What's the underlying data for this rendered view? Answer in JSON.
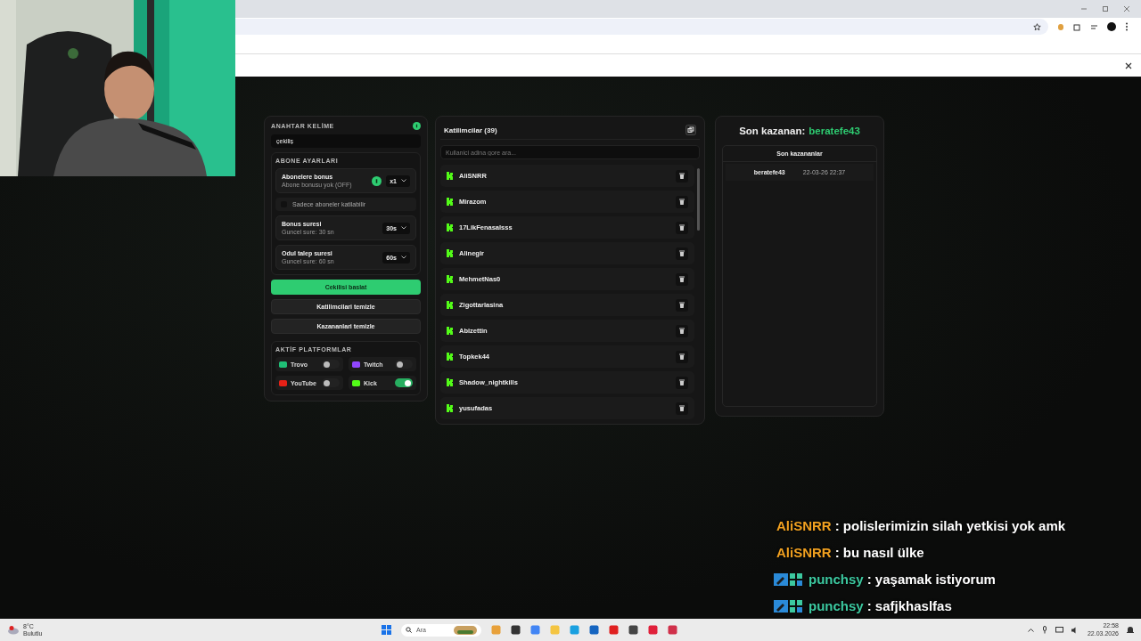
{
  "keyword": {
    "label": "ANAHTAR KELİME",
    "value": "çekiliş"
  },
  "subscriber": {
    "title": "ABONE AYARLARI",
    "rows": [
      {
        "kind": "select",
        "title": "Abonelere bonus",
        "subtitle": "Abone bonusu yok (OFF)",
        "value": "x1",
        "info": true
      },
      {
        "kind": "checkbox",
        "label": "Sadece aboneler katilabilir",
        "checked": false
      },
      {
        "kind": "select",
        "title": "Bonus suresi",
        "subtitle": "Guncel sure: 30 sn",
        "value": "30s",
        "info": false
      },
      {
        "kind": "select",
        "title": "Odul talep suresi",
        "subtitle": "Guncel sure: 60 sn",
        "value": "60s",
        "info": false
      }
    ]
  },
  "buttons": [
    {
      "kind": "primary",
      "label": "Cekilisi baslat"
    },
    {
      "kind": "secondary",
      "label": "Katilimcilari temizle"
    },
    {
      "kind": "secondary",
      "label": "Kazananlari temizle"
    }
  ],
  "platforms": {
    "title": "AKTİF PLATFORMLAR",
    "items": [
      {
        "kind": "trovo",
        "label": "Trovo",
        "on": false
      },
      {
        "kind": "twitch",
        "label": "Twitch",
        "on": false
      },
      {
        "kind": "youtube",
        "label": "YouTube",
        "on": false
      },
      {
        "kind": "kick",
        "label": "Kick",
        "on": true
      }
    ]
  },
  "participants": {
    "title": "Katilimcilar (39)",
    "placeholder": "Kullanici adina gore ara...",
    "items": [
      "AliSNRR",
      "Mirazom",
      "17LikFenasalsss",
      "Alinegir",
      "MehmetNas0",
      "Zigottarlasina",
      "Abizettin",
      "Topkek44",
      "Shadow_nightkills",
      "yusufadas"
    ]
  },
  "winner": {
    "label": "Son kazanan:",
    "name": "beratefe43",
    "table_title": "Son kazananlar",
    "rows": [
      {
        "name": "beratefe43",
        "time": "22-03-26 22:37"
      }
    ]
  },
  "chat": [
    {
      "user": "AliSNRR",
      "text": ": polislerimizin silah yetkisi yok amk",
      "color": "#f0a020",
      "badges": false
    },
    {
      "user": "AliSNRR",
      "text": ": bu nasıl ülke",
      "color": "#f0a020",
      "badges": false
    },
    {
      "user": "punchsy",
      "text": ": yaşamak istiyorum",
      "color": "#3cc9a0",
      "badges": true
    },
    {
      "user": "punchsy",
      "text": ": safjkhaslfas",
      "color": "#3cc9a0",
      "badges": true
    }
  ],
  "taskbar": {
    "temperature": "8°C",
    "weather": "Bulutlu",
    "search": "Ara",
    "time": "22:58",
    "date": "22.03.2026"
  }
}
